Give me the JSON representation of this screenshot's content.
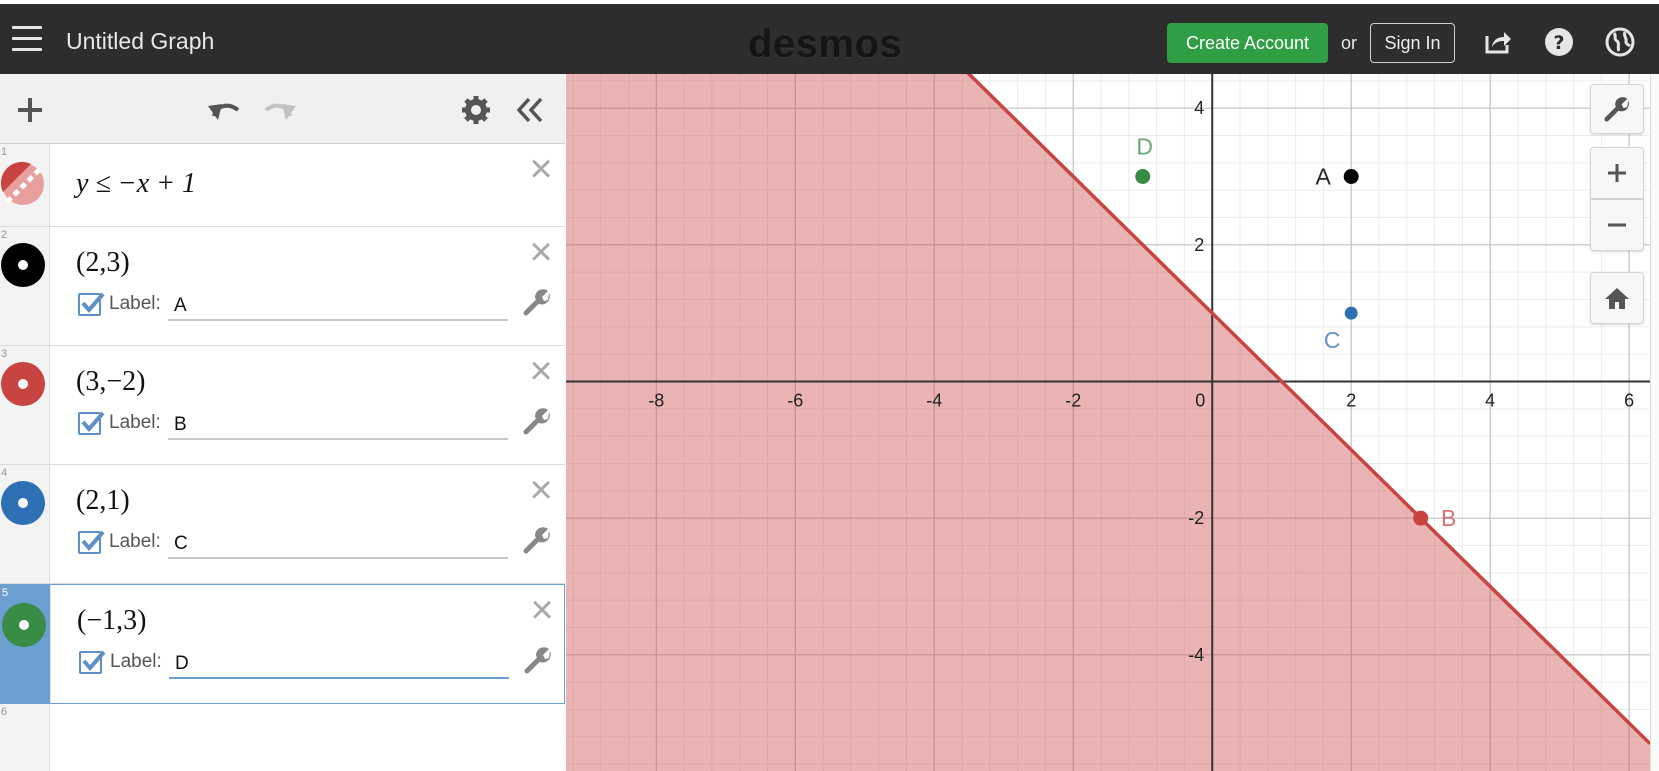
{
  "header": {
    "title": "Untitled Graph",
    "logo": "desmos",
    "create_account": "Create Account",
    "or": "or",
    "sign_in": "Sign In"
  },
  "expressions": [
    {
      "index": "1",
      "latex_display": "y ≤ −x + 1",
      "color": "#c74440"
    },
    {
      "index": "2",
      "latex_display": "(2,3)",
      "color": "#000000",
      "label_caption": "Label:",
      "label_value": "A"
    },
    {
      "index": "3",
      "latex_display": "(3,−2)",
      "color": "#c74440",
      "label_caption": "Label:",
      "label_value": "B"
    },
    {
      "index": "4",
      "latex_display": "(2,1)",
      "color": "#2d70b3",
      "label_caption": "Label:",
      "label_value": "C"
    },
    {
      "index": "5",
      "latex_display": "(−1,3)",
      "color": "#388c46",
      "label_caption": "Label:",
      "label_value": "D"
    },
    {
      "index": "6"
    }
  ],
  "graph": {
    "x_tick_labels": [
      "-8",
      "-6",
      "-4",
      "-2",
      "0",
      "2",
      "4",
      "6"
    ],
    "y_tick_labels": [
      "4",
      "2",
      "-2",
      "-4"
    ],
    "colors": {
      "shade": "#c74440",
      "grid_major": "#c4c4c4",
      "grid_minor": "#ececec",
      "axis": "#333333"
    }
  },
  "chart_data": {
    "type": "scatter",
    "xlim": [
      -9.3,
      6.3
    ],
    "ylim": [
      -5.7,
      4.5
    ],
    "grid": true,
    "inequality": {
      "expression": "y ≤ −x + 1",
      "slope": -1,
      "intercept": 1,
      "shaded": "below"
    },
    "points": [
      {
        "label": "A",
        "x": 2,
        "y": 3,
        "color": "#000000"
      },
      {
        "label": "B",
        "x": 3,
        "y": -2,
        "color": "#c74440"
      },
      {
        "label": "C",
        "x": 2,
        "y": 1,
        "color": "#2d70b3"
      },
      {
        "label": "D",
        "x": -1,
        "y": 3,
        "color": "#388c46"
      }
    ]
  }
}
